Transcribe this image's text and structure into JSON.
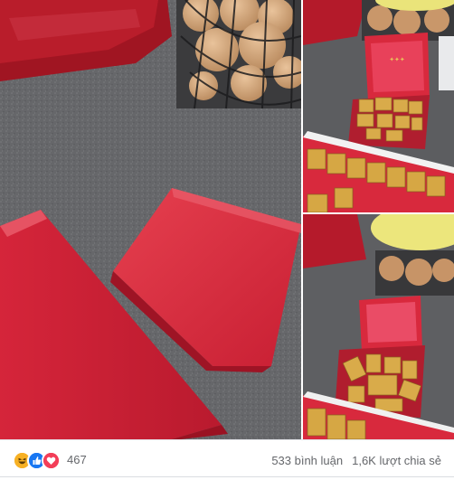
{
  "post": {
    "reaction_icons": [
      "haha-icon",
      "like-icon",
      "love-icon"
    ],
    "reaction_count": "467",
    "comments": "533 bình luận",
    "shares": "1,6K lượt chia sẻ"
  },
  "colors": {
    "velvet_red": "#d8293d",
    "gold": "#d9ab4a",
    "counter_gray": "#6a6a6c",
    "like_blue": "#1877f2",
    "love_red": "#f33e58",
    "haha_yellow": "#f7b125"
  }
}
